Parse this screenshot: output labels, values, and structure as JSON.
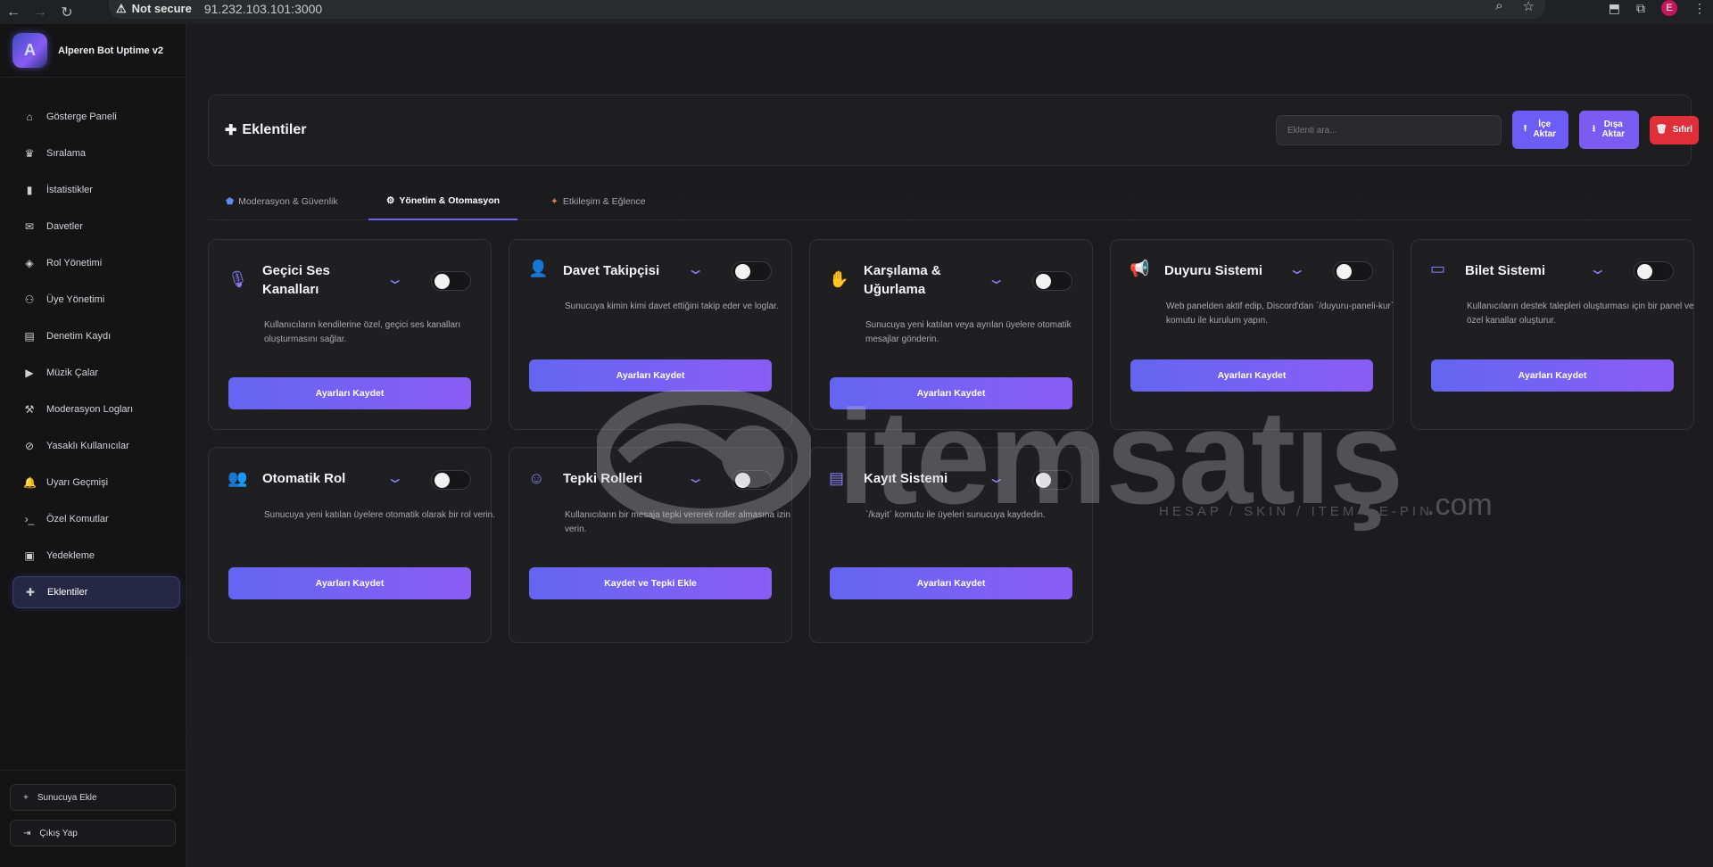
{
  "browser": {
    "security_label": "Not secure",
    "url": "91.232.103.101:3000",
    "profile_initial": "E"
  },
  "sidebar": {
    "brand": "Alperen Bot Uptime v2",
    "items": [
      {
        "label": "Gösterge Paneli",
        "icon": "home-icon"
      },
      {
        "label": "Sıralama",
        "icon": "trophy-icon"
      },
      {
        "label": "İstatistikler",
        "icon": "bar-chart-icon"
      },
      {
        "label": "Davetler",
        "icon": "envelope-icon"
      },
      {
        "label": "Rol Yönetimi",
        "icon": "tag-icon"
      },
      {
        "label": "Üye Yönetimi",
        "icon": "users-icon"
      },
      {
        "label": "Denetim Kaydı",
        "icon": "clipboard-icon"
      },
      {
        "label": "Müzik Çalar",
        "icon": "play-icon"
      },
      {
        "label": "Moderasyon Logları",
        "icon": "hammer-icon"
      },
      {
        "label": "Yasaklı Kullanıcılar",
        "icon": "user-slash-icon"
      },
      {
        "label": "Uyarı Geçmişi",
        "icon": "bell-icon"
      },
      {
        "label": "Özel Komutlar",
        "icon": "terminal-icon"
      },
      {
        "label": "Yedekleme",
        "icon": "save-icon"
      },
      {
        "label": "Eklentiler",
        "icon": "puzzle-icon",
        "active": true
      }
    ],
    "add_server": "Sunucuya Ekle",
    "logout": "Çıkış Yap"
  },
  "header": {
    "title": "Eklentiler",
    "search_placeholder": "Eklenti ara...",
    "import_label": "İçe Aktar",
    "export_label": "Dışa Aktar",
    "reset_label": "Sıfırl"
  },
  "tabs": [
    {
      "label": "Moderasyon & Güvenlik",
      "icon": "shield-icon"
    },
    {
      "label": "Yönetim & Otomasyon",
      "icon": "gear-icon",
      "active": true
    },
    {
      "label": "Etkileşim & Eğlence",
      "icon": "party-icon"
    }
  ],
  "plugins": [
    {
      "title": "Geçici Ses Kanalları",
      "desc": "Kullanıcıların kendilerine özel, geçici ses kanalları oluşturmasını sağlar.",
      "button": "Ayarları Kaydet",
      "icon": "microphone-icon",
      "enabled": false
    },
    {
      "title": "Davet Takipçisi",
      "desc": "Sunucuya kimin kimi davet ettiğini takip eder ve loglar.",
      "button": "Ayarları Kaydet",
      "icon": "user-plus-icon",
      "enabled": false
    },
    {
      "title": "Karşılama & Uğurlama",
      "desc": "Sunucuya yeni katılan veya ayrılan üyelere otomatik mesajlar gönderin.",
      "button": "Ayarları Kaydet",
      "icon": "wave-hand-icon",
      "enabled": false
    },
    {
      "title": "Duyuru Sistemi",
      "desc": "Web panelden aktif edip, Discord'dan `/duyuru-paneli-kur` komutu ile kurulum yapın.",
      "button": "Ayarları Kaydet",
      "icon": "megaphone-icon",
      "enabled": false
    },
    {
      "title": "Bilet Sistemi",
      "desc": "Kullanıcıların destek talepleri oluşturması için bir panel ve özel kanallar oluşturur.",
      "button": "Ayarları Kaydet",
      "icon": "ticket-icon",
      "enabled": false
    },
    {
      "title": "Otomatik Rol",
      "desc": "Sunucuya yeni katılan üyelere otomatik olarak bir rol verin.",
      "button": "Ayarları Kaydet",
      "icon": "user-tag-icon",
      "enabled": false
    },
    {
      "title": "Tepki Rolleri",
      "desc": "Kullanıcıların bir mesaja tepki vererek roller almasına izin verin.",
      "button": "Kaydet ve Tepki Ekle",
      "icon": "masks-icon",
      "enabled": false
    },
    {
      "title": "Kayıt Sistemi",
      "desc": "`/kayit` komutu ile üyeleri sunucuya kaydedin.",
      "button": "Ayarları Kaydet",
      "icon": "id-card-icon",
      "enabled": false
    }
  ],
  "watermark": {
    "brand": "itemsatış",
    "tagline": "HESAP / SKIN / ITEM / E-PIN",
    "suffix": ".com"
  },
  "colors": {
    "accent": "#6f63f5",
    "button_gradient_start": "#6366f1",
    "button_gradient_end": "#8b5cf6",
    "danger": "#e12f3a"
  }
}
